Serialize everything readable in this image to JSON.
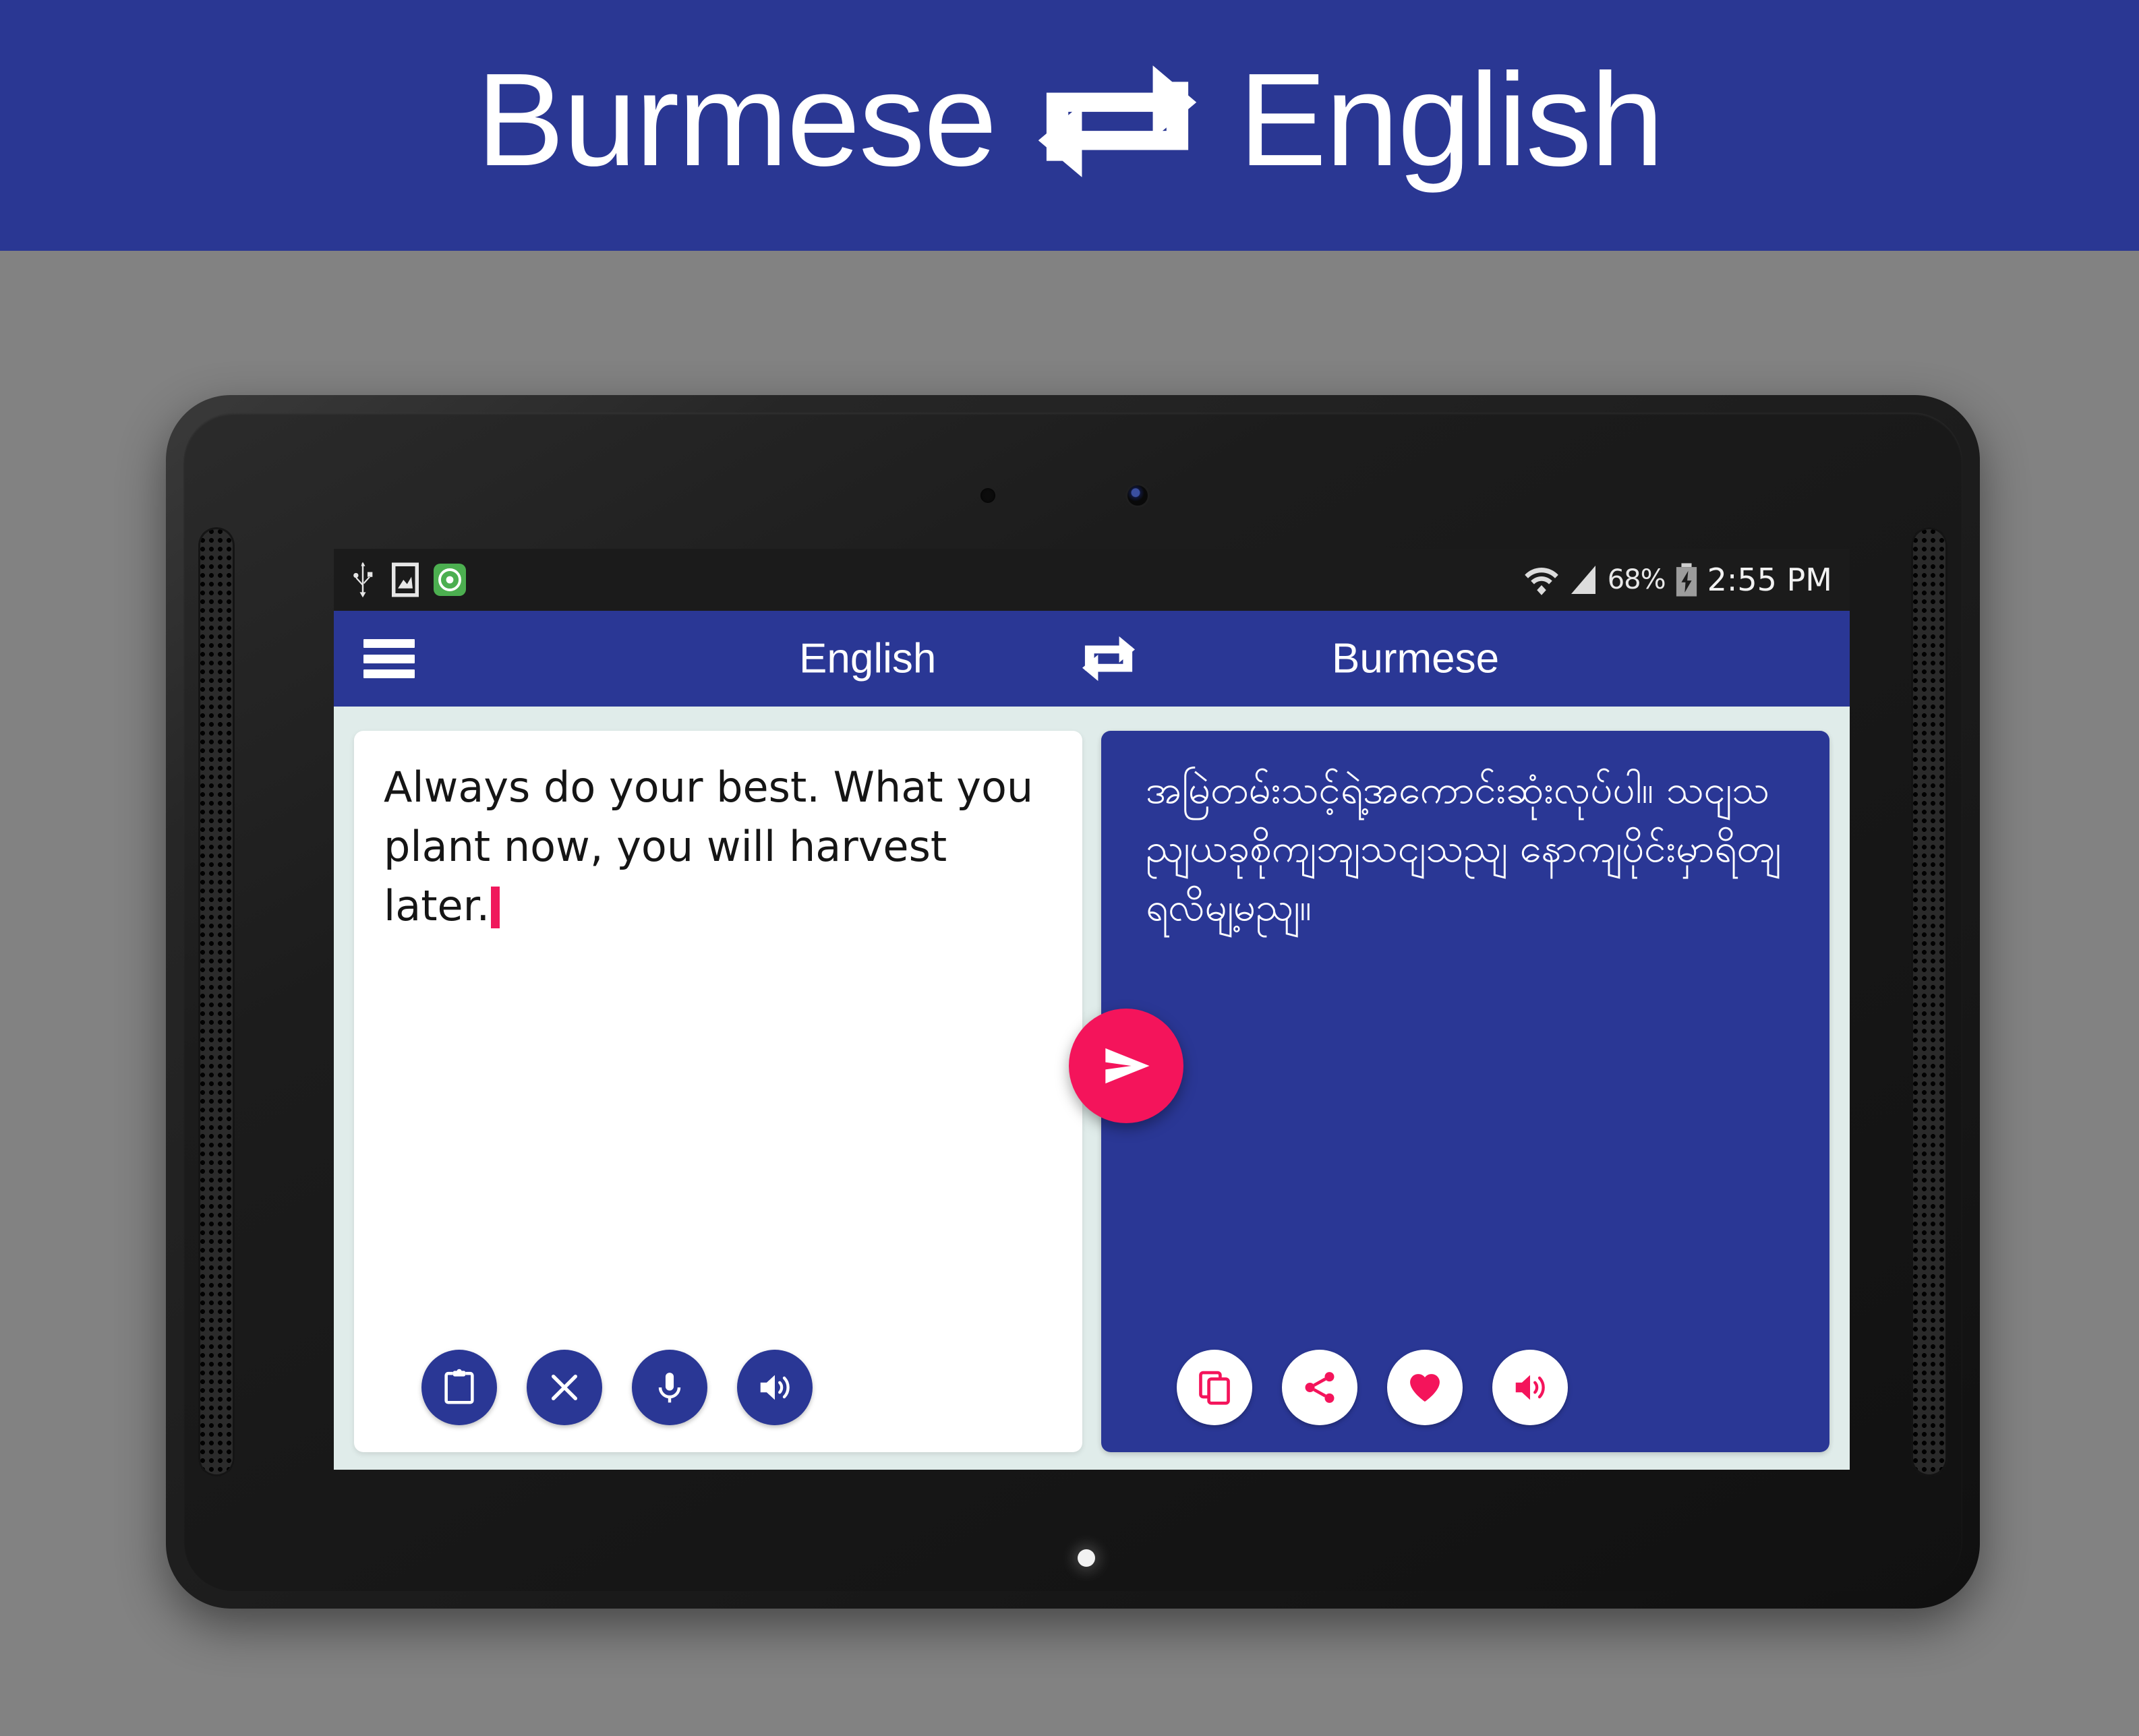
{
  "promo": {
    "source_language": "Burmese",
    "target_language": "English",
    "swap_icon": "swap-arrows-icon",
    "banner_color": "#2a3793",
    "text_color": "#ffffff"
  },
  "device": {
    "type": "android-tablet",
    "body_color": "#1d1d1d",
    "camera_icon": "front-camera",
    "sensor_icon": "proximity-sensor",
    "home_indicator_icon": "home-led-dot"
  },
  "status_bar": {
    "background": "#1b1b1b",
    "left_icons": [
      "usb-icon",
      "screenshot-image-icon",
      "app-notification-icon"
    ],
    "right_icons": [
      "wifi-icon",
      "cell-signal-icon",
      "battery-charging-icon"
    ],
    "battery_percent": "68%",
    "clock": "2:55 PM"
  },
  "toolbar": {
    "background": "#2a3795",
    "menu_icon": "hamburger-menu-icon",
    "source_language": "English",
    "swap_icon": "swap-languages-icon",
    "target_language": "Burmese"
  },
  "source_panel": {
    "background": "#ffffff",
    "text": "Always do your best. What you plant now, you will harvest later.",
    "caret_color": "#f0185c",
    "actions": [
      {
        "name": "paste-button",
        "icon": "clipboard-paste-icon"
      },
      {
        "name": "clear-button",
        "icon": "close-x-icon"
      },
      {
        "name": "voice-input-button",
        "icon": "microphone-icon"
      },
      {
        "name": "speak-source-button",
        "icon": "speaker-volume-icon"
      }
    ],
    "action_bg": "#2a3795",
    "action_fg": "#ffffff"
  },
  "target_panel": {
    "background": "#2a3795",
    "text": "အမြဲတမ်းသင့်ရဲ့အကောင်းဆုံးလုပ်ပါ။ သငျသညျယခုစိုကျဘျသငျသညျ နောကျပိုင်းမှာရိတျရလိမျ့မညျ။",
    "actions": [
      {
        "name": "copy-button",
        "icon": "copy-icon"
      },
      {
        "name": "share-button",
        "icon": "share-icon"
      },
      {
        "name": "favorite-button",
        "icon": "heart-icon"
      },
      {
        "name": "speak-target-button",
        "icon": "speaker-volume-icon"
      }
    ],
    "action_bg": "#ffffff",
    "action_fg": "#f4145b"
  },
  "send": {
    "name": "translate-send-button",
    "icon": "send-arrow-icon",
    "color": "#f4145b",
    "icon_color": "#ffffff"
  },
  "theme": {
    "app_blue": "#2a3795",
    "accent_pink": "#f4145b",
    "page_background": "#828282",
    "panel_background": "#e0ecea"
  }
}
